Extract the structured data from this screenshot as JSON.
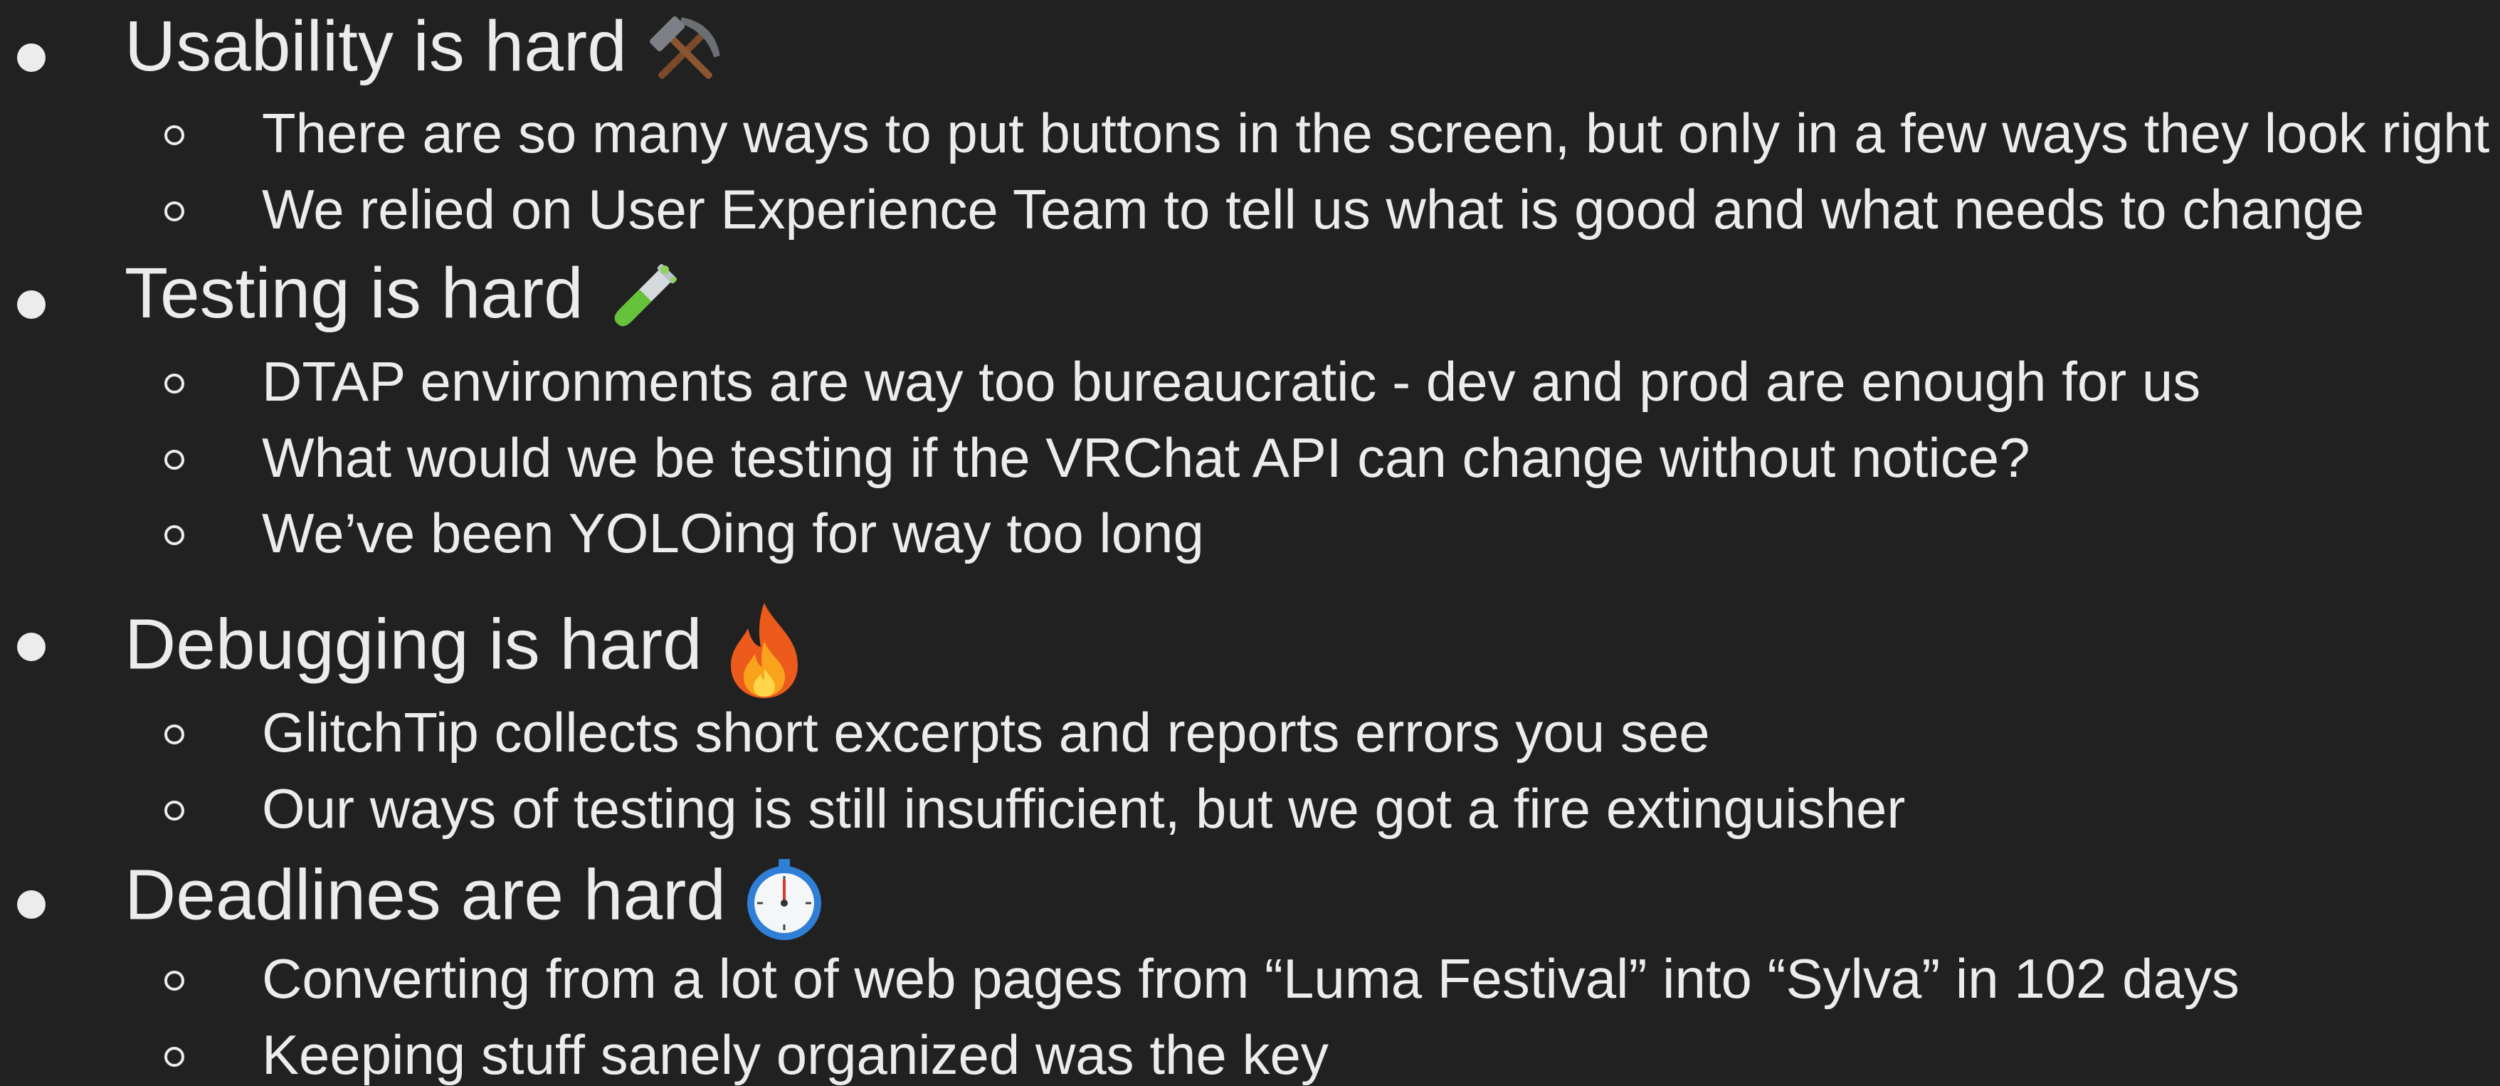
{
  "sections": [
    {
      "heading": "Usability is hard",
      "icon": "hammer-and-pick-icon",
      "items": [
        "There are so many ways to put buttons in the screen, but only in a few ways they look right",
        "We relied on User Experience Team to tell us what is good and what needs to change"
      ]
    },
    {
      "heading": "Testing is hard",
      "icon": "test-tube-icon",
      "items": [
        "DTAP environments are way too bureaucratic - dev and prod are enough for us",
        "What would we be testing if the VRChat API can change without notice?",
        "We’ve been YOLOing for way too long"
      ]
    },
    {
      "heading": "Debugging is hard",
      "icon": "fire-icon",
      "items": [
        "GlitchTip collects short excerpts and reports errors you see",
        "Our ways of testing is still insufficient, but we got a fire extinguisher"
      ]
    },
    {
      "heading": "Deadlines are hard",
      "icon": "stopwatch-icon",
      "items": [
        "Converting from a lot of web pages from “Luma Festival” into “Sylva” in 102 days",
        "Keeping stuff sanely organized was the key"
      ]
    }
  ],
  "colors": {
    "background": "#212121",
    "text": "#ececec"
  }
}
